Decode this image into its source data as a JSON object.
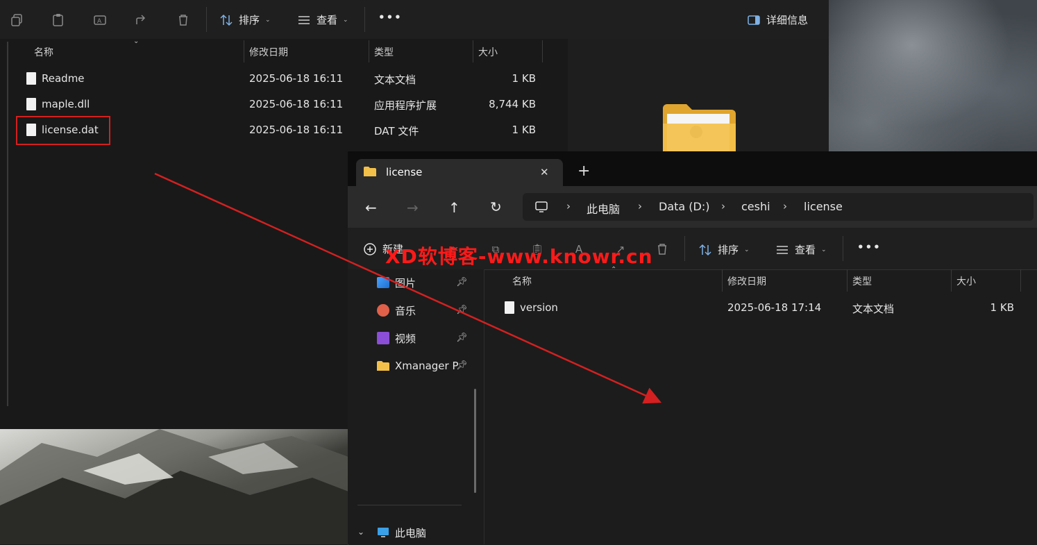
{
  "back_window": {
    "toolbar": {
      "sort_label": "排序",
      "view_label": "查看",
      "more_label": "•••",
      "details_label": "详细信息"
    },
    "columns": [
      "名称",
      "修改日期",
      "类型",
      "大小"
    ],
    "files": [
      {
        "name": "Readme",
        "date": "2025-06-18 16:11",
        "type": "文本文档",
        "size": "1 KB",
        "icon": "text-file-icon"
      },
      {
        "name": "maple.dll",
        "date": "2025-06-18 16:11",
        "type": "应用程序扩展",
        "size": "8,744 KB",
        "icon": "dll-file-icon"
      },
      {
        "name": "license.dat",
        "date": "2025-06-18 16:11",
        "type": "DAT 文件",
        "size": "1 KB",
        "icon": "blank-file-icon"
      }
    ]
  },
  "front_window": {
    "tab_title": "license",
    "new_tab": "+",
    "close": "✕",
    "breadcrumb": [
      "此电脑",
      "Data (D:)",
      "ceshi",
      "license"
    ],
    "toolbar": {
      "new_label": "新建",
      "sort_label": "排序",
      "view_label": "查看",
      "more_label": "•••"
    },
    "nav_items": [
      {
        "label": "图片",
        "icon": "pictures-icon"
      },
      {
        "label": "音乐",
        "icon": "music-icon"
      },
      {
        "label": "视频",
        "icon": "videos-icon"
      },
      {
        "label": "Xmanager P",
        "icon": "folder-icon"
      }
    ],
    "this_pc_label": "此电脑",
    "columns": [
      "名称",
      "修改日期",
      "类型",
      "大小"
    ],
    "files": [
      {
        "name": "version",
        "date": "2025-06-18 17:14",
        "type": "文本文档",
        "size": "1 KB",
        "icon": "text-file-icon"
      }
    ]
  },
  "watermark": "XD软博客-www.knowr.cn",
  "colors": {
    "annotation_red": "#d42020",
    "folder_yellow": "#f3c04a"
  }
}
